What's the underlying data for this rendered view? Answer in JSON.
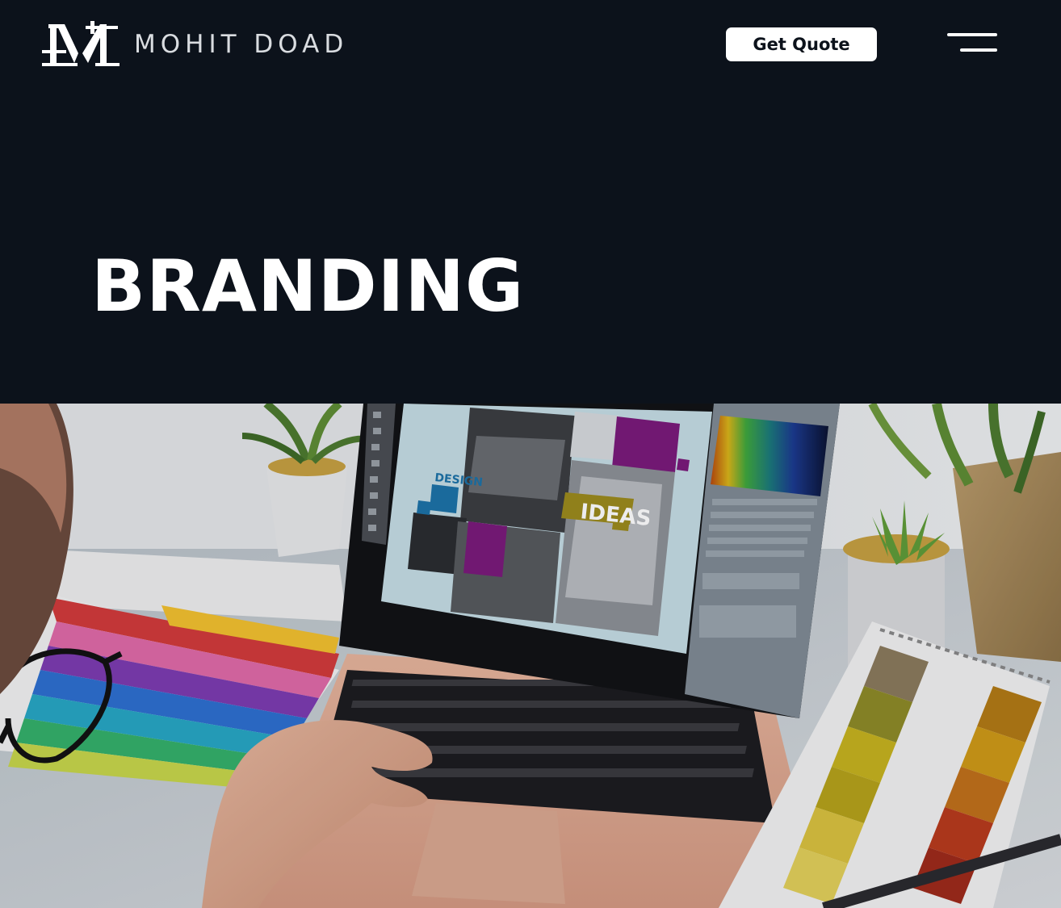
{
  "header": {
    "logo_text": "MOHIT DOAD",
    "cta_label": "Get Quote",
    "menu_icon": "hamburger-menu-icon"
  },
  "hero": {
    "title": "BRANDING"
  },
  "illustration": {
    "label_design": "DESIGN",
    "label_ideas": "IDEAS"
  },
  "colors": {
    "background": "#0c121b",
    "button_bg": "#ffffff",
    "button_text": "#0c121b",
    "title": "#ffffff"
  }
}
